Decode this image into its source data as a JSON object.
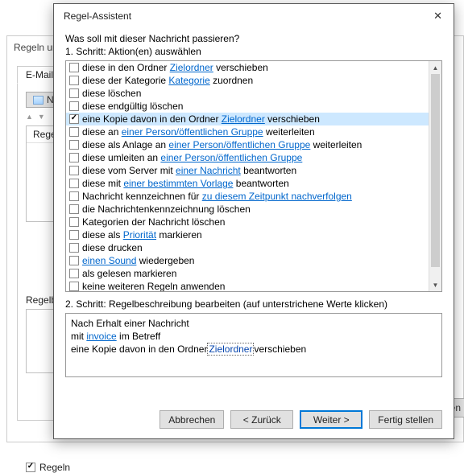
{
  "background": {
    "title": "Regeln und",
    "tab": "E-Mail-Re",
    "new_btn": "Neue",
    "list_header": "Regel",
    "desc_label": "Regelbes",
    "checkbox_label": "Regeln",
    "apply_btn": "Übernehmen"
  },
  "wizard": {
    "title": "Regel-Assistent",
    "question": "Was soll mit dieser Nachricht passieren?",
    "step1": "1. Schritt: Aktion(en) auswählen",
    "step2": "2. Schritt: Regelbeschreibung bearbeiten (auf unterstrichene Werte klicken)",
    "actions": [
      {
        "checked": false,
        "selected": false,
        "parts": [
          "diese in den Ordner ",
          {
            "u": "Zielordner"
          },
          " verschieben"
        ]
      },
      {
        "checked": false,
        "selected": false,
        "parts": [
          "diese der Kategorie ",
          {
            "u": "Kategorie"
          },
          " zuordnen"
        ]
      },
      {
        "checked": false,
        "selected": false,
        "parts": [
          "diese löschen"
        ]
      },
      {
        "checked": false,
        "selected": false,
        "parts": [
          "diese endgültig löschen"
        ]
      },
      {
        "checked": true,
        "selected": true,
        "parts": [
          "eine Kopie davon in den Ordner ",
          {
            "u": "Zielordner"
          },
          " verschieben"
        ]
      },
      {
        "checked": false,
        "selected": false,
        "parts": [
          "diese an ",
          {
            "u": "einer Person/öffentlichen Gruppe"
          },
          " weiterleiten"
        ]
      },
      {
        "checked": false,
        "selected": false,
        "parts": [
          "diese als Anlage an ",
          {
            "u": "einer Person/öffentlichen Gruppe"
          },
          " weiterleiten"
        ]
      },
      {
        "checked": false,
        "selected": false,
        "parts": [
          "diese umleiten an ",
          {
            "u": "einer Person/öffentlichen Gruppe"
          }
        ]
      },
      {
        "checked": false,
        "selected": false,
        "parts": [
          "diese vom Server mit ",
          {
            "u": "einer Nachricht"
          },
          " beantworten"
        ]
      },
      {
        "checked": false,
        "selected": false,
        "parts": [
          "diese mit ",
          {
            "u": "einer bestimmten Vorlage"
          },
          " beantworten"
        ]
      },
      {
        "checked": false,
        "selected": false,
        "parts": [
          "Nachricht kennzeichnen für ",
          {
            "u": "zu diesem Zeitpunkt nachverfolgen"
          }
        ]
      },
      {
        "checked": false,
        "selected": false,
        "parts": [
          "die Nachrichtenkennzeichnung löschen"
        ]
      },
      {
        "checked": false,
        "selected": false,
        "parts": [
          "Kategorien der Nachricht löschen"
        ]
      },
      {
        "checked": false,
        "selected": false,
        "parts": [
          "diese als ",
          {
            "u": "Priorität"
          },
          " markieren"
        ]
      },
      {
        "checked": false,
        "selected": false,
        "parts": [
          "diese drucken"
        ]
      },
      {
        "checked": false,
        "selected": false,
        "parts": [
          {
            "u": "einen Sound"
          },
          " wiedergeben"
        ]
      },
      {
        "checked": false,
        "selected": false,
        "parts": [
          "als gelesen markieren"
        ]
      },
      {
        "checked": false,
        "selected": false,
        "parts": [
          "keine weiteren Regeln anwenden"
        ]
      }
    ],
    "description": {
      "line1": "Nach Erhalt einer Nachricht",
      "line2_pre": "mit ",
      "line2_link": "invoice",
      "line2_post": " im Betreff",
      "line3_pre": "eine Kopie davon in den Ordner",
      "line3_link": "Zielordner",
      "line3_post": "verschieben"
    },
    "buttons": {
      "cancel": "Abbrechen",
      "back": "< Zurück",
      "next": "Weiter >",
      "finish": "Fertig stellen"
    }
  }
}
